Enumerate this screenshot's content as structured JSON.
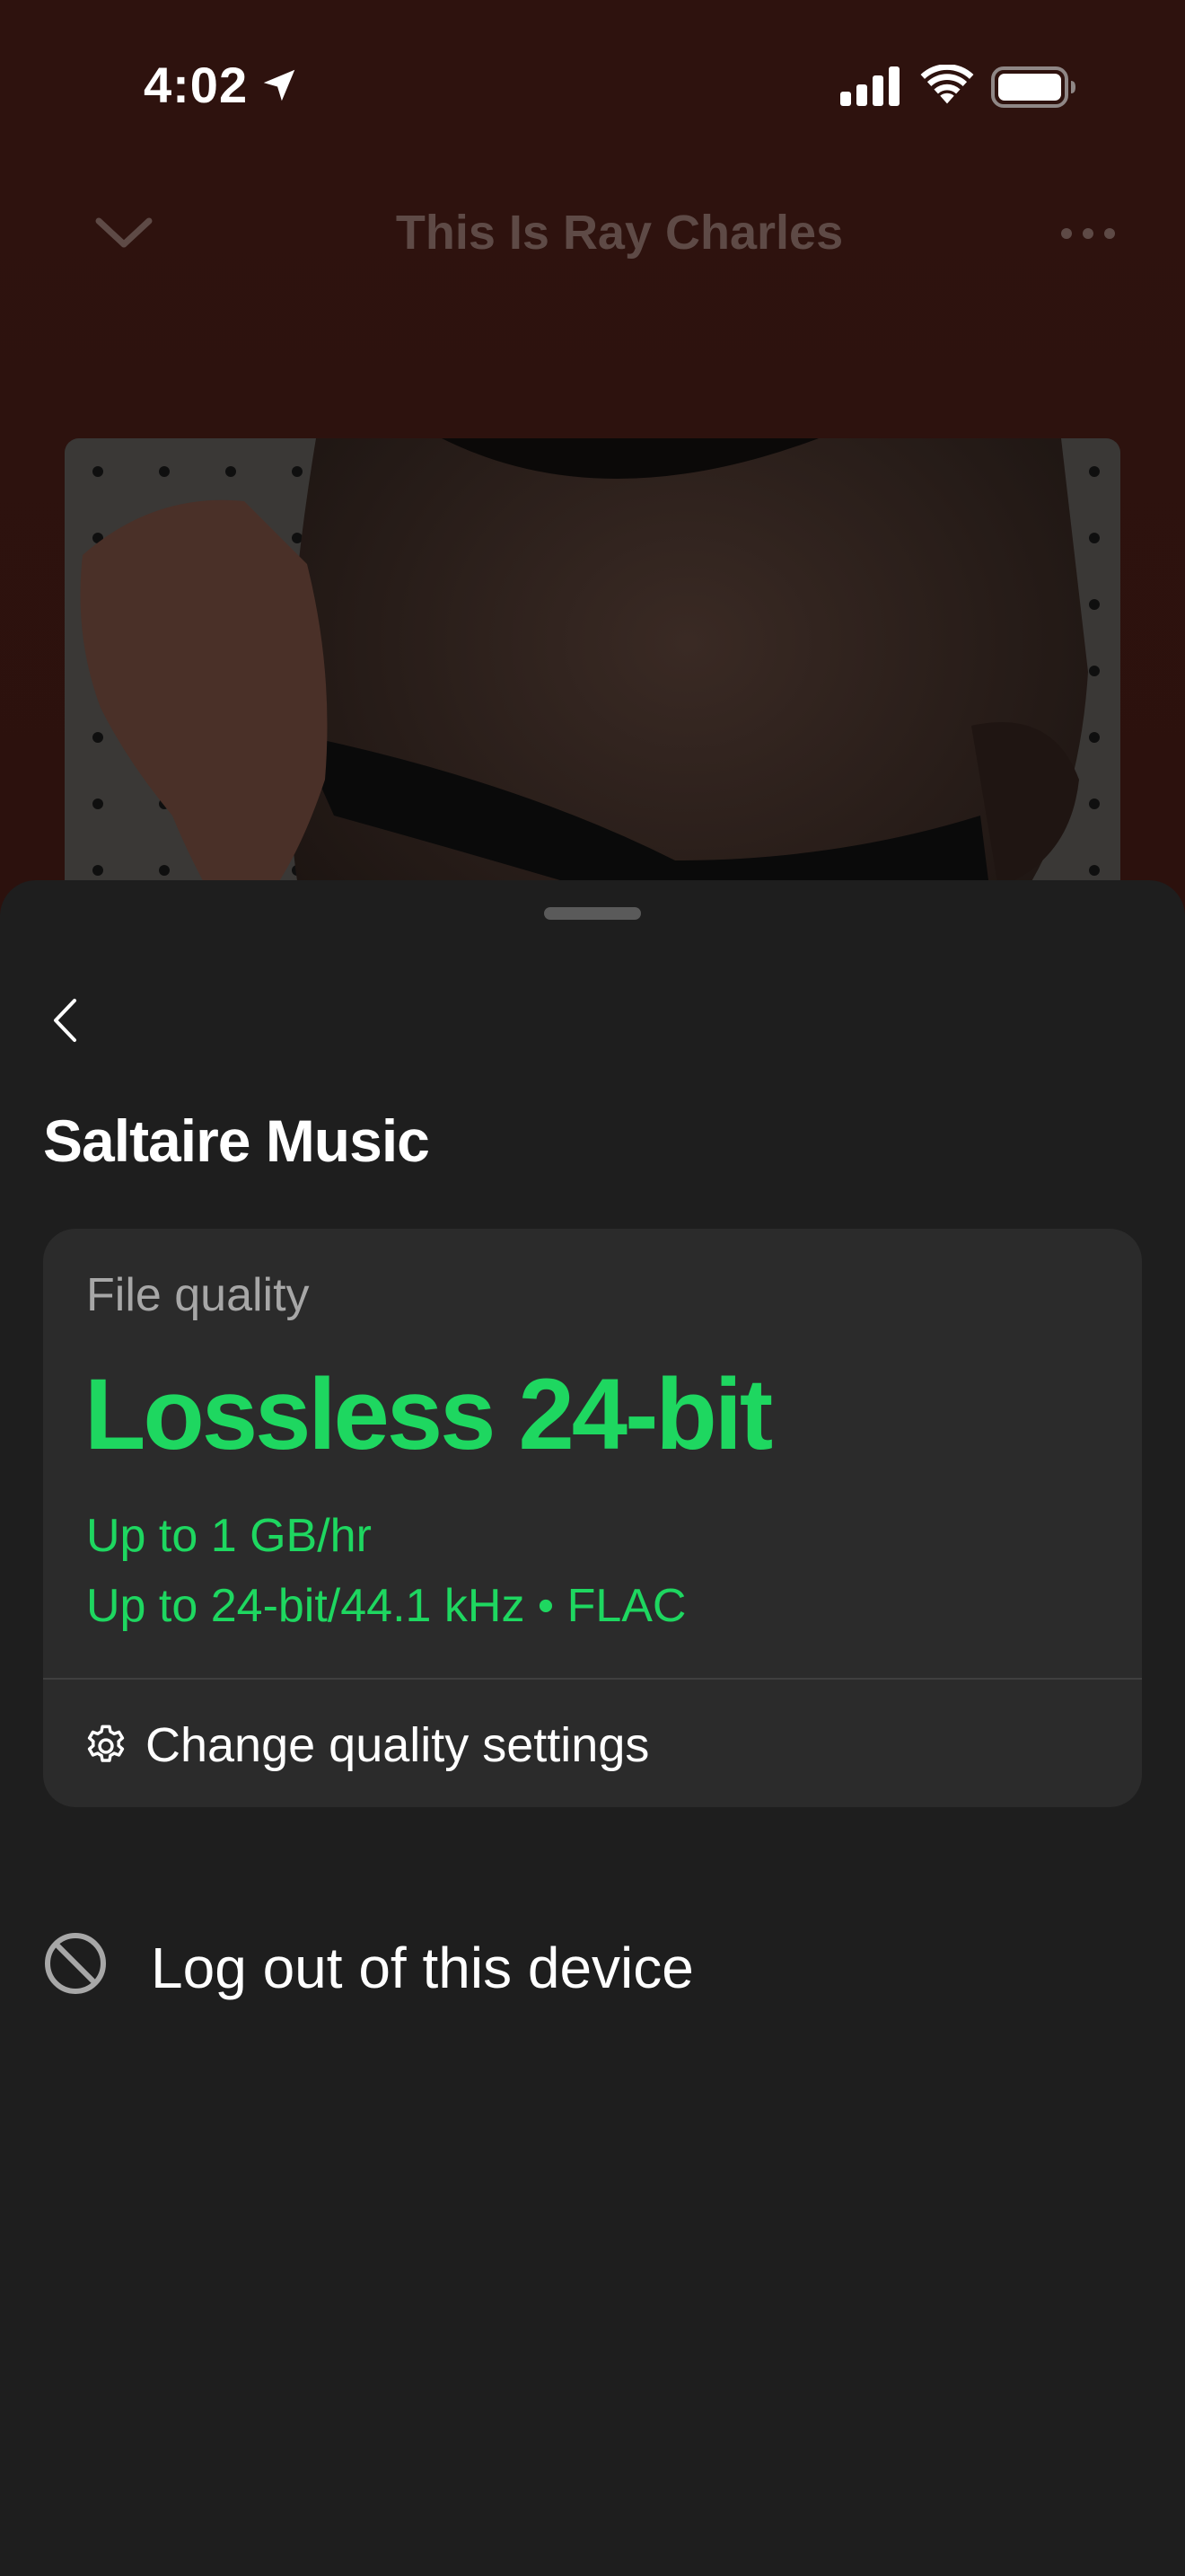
{
  "status_bar": {
    "time": "4:02"
  },
  "player": {
    "title": "This Is Ray Charles",
    "collapse_icon": "chevron-down-icon",
    "more_icon": "more-horizontal-icon"
  },
  "sheet": {
    "back_icon": "chevron-left-icon",
    "title": "Saltaire Music",
    "quality_card": {
      "label": "File quality",
      "value": "Lossless 24-bit",
      "detail_1": "Up to 1 GB/hr",
      "detail_2": "Up to 24-bit/44.1 kHz • FLAC",
      "change_settings_label": "Change quality settings",
      "change_settings_icon": "gear-icon"
    },
    "logout": {
      "label": "Log out of this device",
      "icon": "block-icon"
    }
  },
  "colors": {
    "accent": "#1ed760",
    "sheet_background": "#1e1e1e",
    "card_background": "#2b2b2b",
    "player_background": "#2c120e"
  }
}
